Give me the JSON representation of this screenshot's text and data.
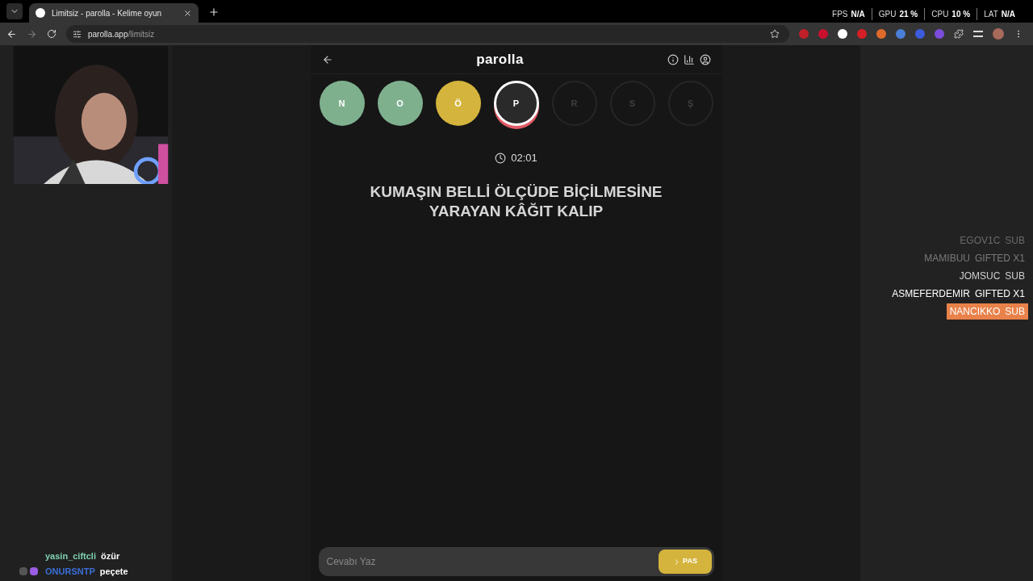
{
  "browser": {
    "tab_title": "Limitsiz - parolla - Kelime oyun",
    "address_host": "parolla.app",
    "address_path": "/limitsiz"
  },
  "stats": [
    {
      "label": "FPS",
      "value": "N/A"
    },
    {
      "label": "GPU",
      "value": "21 %"
    },
    {
      "label": "CPU",
      "value": "10 %"
    },
    {
      "label": "LAT",
      "value": "N/A"
    }
  ],
  "game": {
    "title": "parolla",
    "letters": [
      {
        "letter": "N",
        "kind": "correct"
      },
      {
        "letter": "O",
        "kind": "correct"
      },
      {
        "letter": "Ö",
        "kind": "passed"
      },
      {
        "letter": "P",
        "kind": "current"
      },
      {
        "letter": "R",
        "kind": "pending"
      },
      {
        "letter": "S",
        "kind": "pending"
      },
      {
        "letter": "Ş",
        "kind": "pending"
      }
    ],
    "timer": "02:01",
    "question": "KUMAŞIN BELLİ ÖLÇÜDE BİÇİLMESİNE YARAYAN KÂĞIT KALIP",
    "answer": {
      "placeholder": "Cevabı Yaz"
    },
    "pass_button": "PAS"
  },
  "alerts": [
    {
      "name": "EGOV1C",
      "event": "SUB",
      "kind": "faded"
    },
    {
      "name": "MAMIBUU",
      "event": "GIFTED X1",
      "kind": "dim"
    },
    {
      "name": "JOMSUC",
      "event": "SUB",
      "kind": "plain"
    },
    {
      "name": "ASMEFERDEMIR",
      "event": "GIFTED X1",
      "kind": "bright"
    },
    {
      "name": "NANCIKKO",
      "event": "SUB",
      "kind": "highlight"
    }
  ],
  "chat": [
    {
      "user": "yasin_ciftcli",
      "message": "özür",
      "color": "#7fd1b0",
      "badges": false
    },
    {
      "user": "ONURSNTP",
      "message": "peçete",
      "color": "#3b6fd8",
      "badges": true
    }
  ]
}
